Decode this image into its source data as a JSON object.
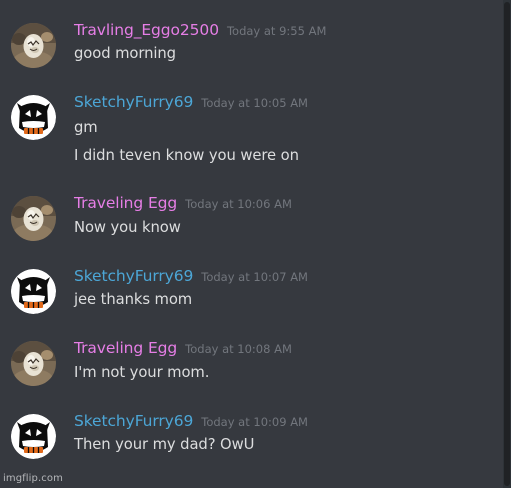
{
  "colors": {
    "background": "#36393f",
    "text": "#dcddde",
    "timestamp": "#72767d",
    "egg_username": "#e67ee6",
    "furry_username": "#4ca6d6"
  },
  "messages": [
    {
      "author": "Travling_Eggo2500",
      "avatar_icon": "egg-avatar-icon",
      "timestamp": "Today at 9:55 AM",
      "lines": [
        "good morning"
      ]
    },
    {
      "author": "SketchyFurry69",
      "avatar_icon": "furry-mask-avatar-icon",
      "timestamp": "Today at 10:05 AM",
      "lines": [
        "gm",
        "I didn teven know you were on"
      ]
    },
    {
      "author": "Traveling Egg",
      "avatar_icon": "egg-avatar-icon",
      "timestamp": "Today at 10:06 AM",
      "lines": [
        "Now you know"
      ]
    },
    {
      "author": "SketchyFurry69",
      "avatar_icon": "furry-mask-avatar-icon",
      "timestamp": "Today at 10:07 AM",
      "lines": [
        "jee thanks mom"
      ]
    },
    {
      "author": "Traveling Egg",
      "avatar_icon": "egg-avatar-icon",
      "timestamp": "Today at 10:08 AM",
      "lines": [
        "I'm not your mom."
      ]
    },
    {
      "author": "SketchyFurry69",
      "avatar_icon": "furry-mask-avatar-icon",
      "timestamp": "Today at 10:09 AM",
      "lines": [
        "Then your my dad? OwU"
      ]
    }
  ],
  "watermark": "imgflip.com"
}
